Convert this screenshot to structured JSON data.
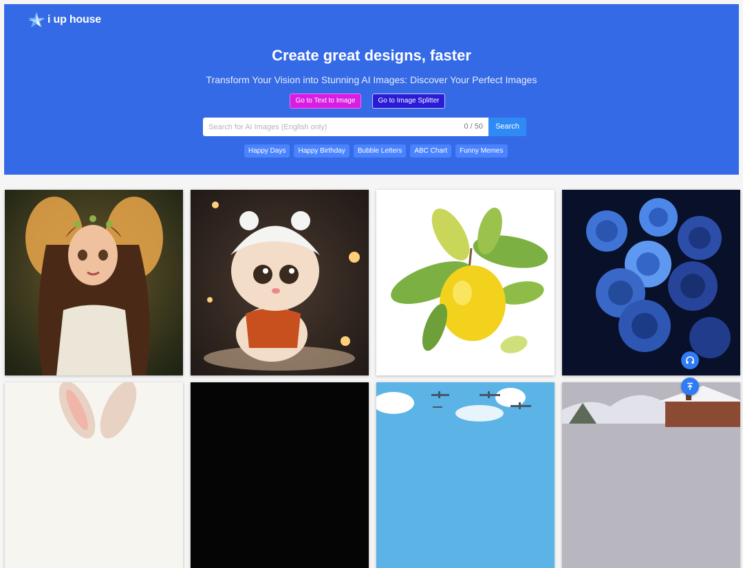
{
  "brand": {
    "name": "i up house"
  },
  "hero": {
    "title": "Create great designs, faster",
    "subtitle": "Transform Your Vision into Stunning AI Images: Discover Your Perfect Images",
    "buttons": {
      "text_to_image": "Go to Text to Image",
      "image_splitter": "Go to Image Splitter"
    }
  },
  "search": {
    "placeholder": "Search for AI Images (English only)",
    "value": "",
    "counter": "0 / 50",
    "button_label": "Search"
  },
  "tags": [
    "Happy Days",
    "Happy Birthday",
    "Bubble Letters",
    "ABC Chart",
    "Funny Memes"
  ],
  "gallery": [
    {
      "icon": "fairy-girl-image"
    },
    {
      "icon": "kitten-in-hat-image"
    },
    {
      "icon": "lemon-illustration-image"
    },
    {
      "icon": "blue-roses-image"
    },
    {
      "icon": "bunny-ears-image"
    },
    {
      "icon": "dark-image"
    },
    {
      "icon": "airplanes-sky-image"
    },
    {
      "icon": "snowy-house-image"
    }
  ],
  "colors": {
    "hero_bg": "#356ae6",
    "btn_text_to_image": "#d81ee3",
    "btn_image_splitter": "#2a1bd6",
    "search_button": "#2f8af5",
    "tag_bg": "#4a83ff",
    "float_button": "#2f7bf3"
  },
  "floating_buttons": {
    "support": "headphones-icon",
    "back_to_top": "arrow-up-icon"
  }
}
